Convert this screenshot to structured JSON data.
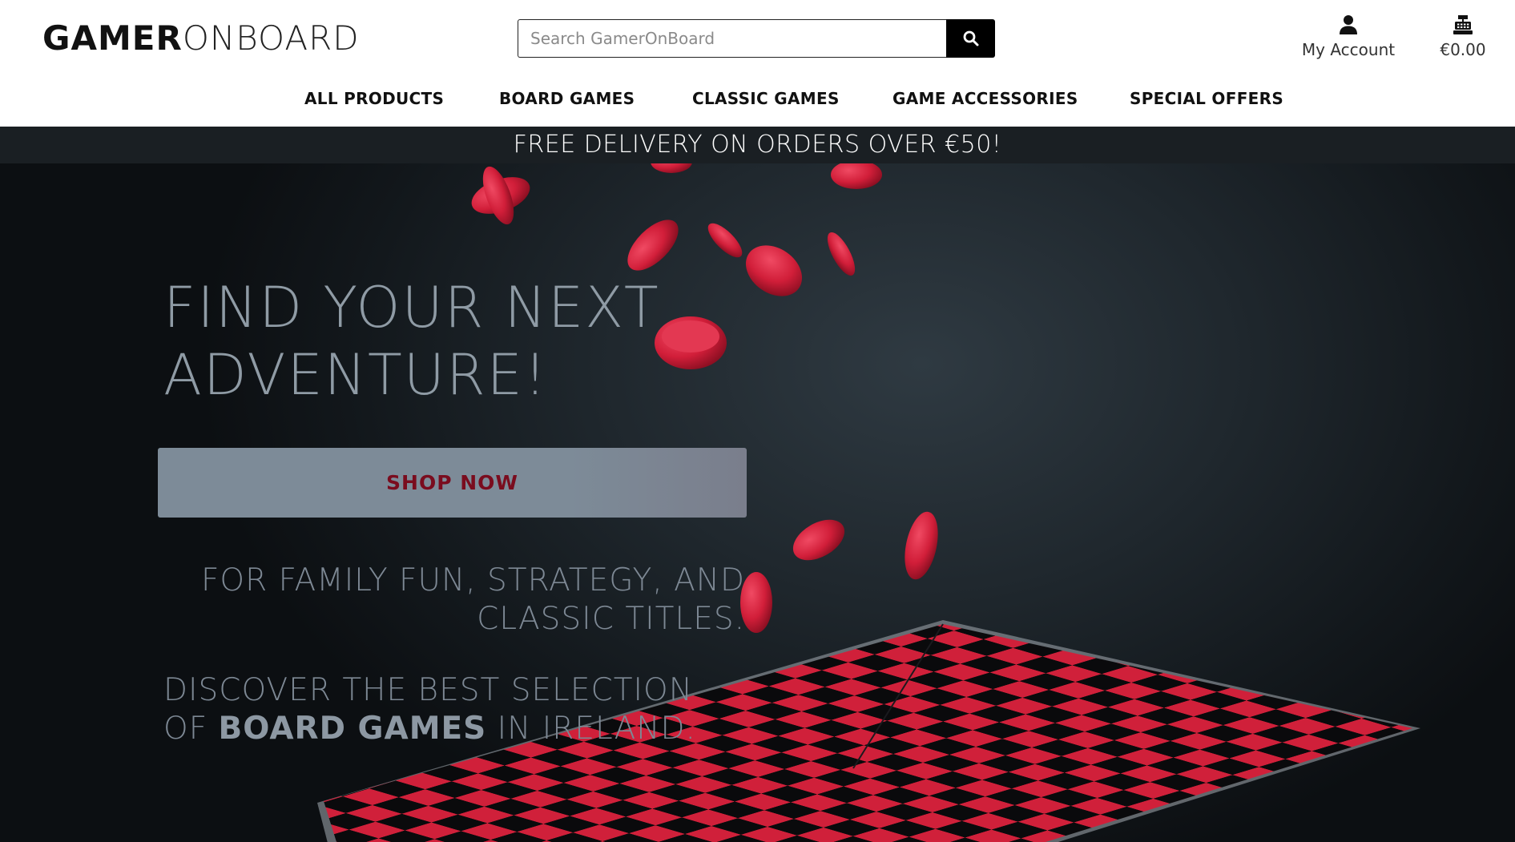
{
  "header": {
    "logo_bold": "GAMER",
    "logo_light": "ONBOARD",
    "search": {
      "placeholder": "Search GamerOnBoard"
    },
    "account_label": "My Account",
    "cart_total": "€0.00"
  },
  "nav": {
    "items": [
      {
        "label": "ALL PRODUCTS"
      },
      {
        "label": "BOARD GAMES"
      },
      {
        "label": "CLASSIC GAMES"
      },
      {
        "label": "GAME ACCESSORIES"
      },
      {
        "label": "SPECIAL OFFERS"
      }
    ]
  },
  "banner": {
    "text": "FREE DELIVERY ON ORDERS OVER €50!"
  },
  "hero": {
    "headline_line1": "FIND YOUR NEXT",
    "headline_line2": "ADVENTURE!",
    "shop_button": "SHOP NOW",
    "tagline_line1": "FOR FAMILY FUN, STRATEGY, AND",
    "tagline_line2": "CLASSIC TITLES.",
    "discover_line1": "DISCOVER THE BEST SELECTION",
    "discover_prefix": "OF ",
    "discover_strong": "BOARD GAMES",
    "discover_suffix": " IN IRELAND."
  },
  "colors": {
    "accent_red": "#d3213b",
    "banner_bg": "#1a1f23",
    "shop_button_bg": "#7d8b98",
    "shop_button_text": "#7a0c1e",
    "hero_text": "#8f9ba5"
  },
  "icons": {
    "search": "search-icon",
    "account": "user-icon",
    "cart": "cash-register-icon"
  }
}
